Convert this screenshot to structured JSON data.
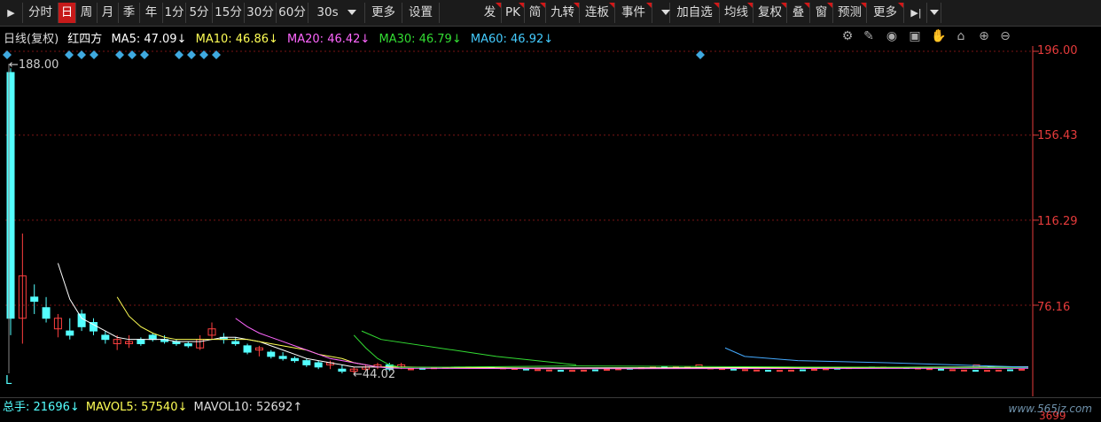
{
  "toolbar": {
    "left_items": [
      "分时",
      "日",
      "周",
      "月",
      "季",
      "年",
      "1分",
      "5分",
      "15分",
      "30分",
      "60分"
    ],
    "interval_select": "30s",
    "more1": "更多",
    "settings": "设置",
    "mid_items": [
      "发",
      "PK",
      "简",
      "九转",
      "连板",
      "事件"
    ],
    "right_items": [
      "加自选",
      "均线",
      "复权",
      "叠",
      "窗",
      "预测",
      "更多"
    ]
  },
  "ma_header": {
    "title": "日线(复权)",
    "stock": "红四方",
    "ma5": "MA5: 47.09↓",
    "ma10": "MA10: 46.86↓",
    "ma20": "MA20: 46.42↓",
    "ma30": "MA30: 46.79↓",
    "ma60": "MA60: 46.92↓"
  },
  "colors": {
    "up": "#ff4040",
    "down": "#54ffff",
    "ma5": "#ffffff",
    "ma10": "#ffff55",
    "ma20": "#ff66ff",
    "ma30": "#33dd33",
    "ma60": "#44aaff",
    "axis": "#e63b3b"
  },
  "y_axis": {
    "labels": [
      "196.00",
      "156.43",
      "116.29",
      "76.16"
    ]
  },
  "annotations": {
    "high": "←188.00",
    "low": "44.02",
    "marker_L": "L"
  },
  "volume": {
    "total": "总手: 21696↓",
    "mavol5": "MAVOL5: 57540↓",
    "mavol10": "MAVOL10: 52692↑",
    "axis_value": "3699"
  },
  "watermark": "www.565jz.com",
  "chart_data": {
    "type": "candlestick",
    "ylim": [
      44,
      196
    ],
    "y_ticks": [
      196.0,
      156.43,
      116.29,
      76.16
    ],
    "candles": [
      [
        186,
        188,
        62,
        70
      ],
      [
        70,
        110,
        58,
        90
      ],
      [
        80,
        86,
        72,
        78
      ],
      [
        75,
        80,
        68,
        70
      ],
      [
        65,
        72,
        61,
        70
      ],
      [
        64,
        70,
        60,
        62
      ],
      [
        72,
        74,
        64,
        66
      ],
      [
        68,
        70,
        62,
        64
      ],
      [
        62,
        64,
        58,
        60
      ],
      [
        58,
        62,
        55,
        60
      ],
      [
        58,
        62,
        56,
        59
      ],
      [
        60,
        61,
        57,
        58
      ],
      [
        62,
        63,
        59,
        60
      ],
      [
        60,
        62,
        58,
        59
      ],
      [
        59,
        60,
        57,
        58
      ],
      [
        58,
        59,
        56,
        57
      ],
      [
        56,
        62,
        55,
        60
      ],
      [
        62,
        68,
        60,
        65
      ],
      [
        61,
        63,
        58,
        60
      ],
      [
        59,
        61,
        57,
        58
      ],
      [
        57,
        58,
        53,
        54
      ],
      [
        55,
        57,
        52,
        56
      ],
      [
        54,
        55,
        51,
        52
      ],
      [
        52,
        54,
        50,
        51
      ],
      [
        51,
        52,
        49,
        50
      ],
      [
        50,
        51,
        47,
        48
      ],
      [
        49,
        50,
        46,
        47
      ],
      [
        48,
        50,
        46,
        49
      ],
      [
        46,
        48,
        44,
        45
      ],
      [
        45,
        47,
        44,
        46
      ],
      [
        46,
        48,
        45,
        47
      ],
      [
        47,
        49,
        46,
        48
      ],
      [
        48,
        49,
        45,
        46
      ],
      [
        47,
        49,
        46,
        48
      ]
    ],
    "ma5": [
      null,
      null,
      null,
      null,
      96,
      79,
      70,
      67,
      64,
      61,
      60,
      60,
      60,
      60,
      59,
      59,
      59,
      60,
      61,
      61,
      60,
      59,
      57,
      55,
      53,
      51,
      50,
      49,
      48,
      47,
      47,
      47,
      47,
      47
    ],
    "ma10": [
      null,
      null,
      null,
      null,
      null,
      null,
      null,
      null,
      null,
      80,
      71,
      66,
      63,
      61,
      60,
      60,
      60,
      60,
      60,
      60,
      60,
      59,
      58,
      57,
      56,
      55,
      53,
      52,
      51,
      49,
      48,
      47,
      47,
      47
    ],
    "ma20": [
      null,
      null,
      null,
      null,
      null,
      null,
      null,
      null,
      null,
      null,
      null,
      null,
      null,
      null,
      null,
      null,
      null,
      null,
      null,
      70,
      66,
      63,
      61,
      59,
      57,
      55,
      53,
      51,
      50,
      49,
      48,
      47,
      46.5,
      46.4
    ],
    "ma30": [
      null,
      null,
      null,
      null,
      null,
      null,
      null,
      null,
      null,
      null,
      null,
      null,
      null,
      null,
      null,
      null,
      null,
      null,
      null,
      null,
      null,
      null,
      null,
      null,
      null,
      null,
      null,
      null,
      null,
      62,
      56,
      51,
      48,
      46.8
    ],
    "ma60": [
      null,
      null,
      null,
      null,
      null,
      null,
      null,
      null,
      null,
      null,
      null,
      null,
      null,
      null,
      null,
      null,
      null,
      null,
      null,
      null,
      null,
      null,
      null,
      null,
      null,
      null,
      null,
      null,
      null,
      null,
      null,
      54,
      50,
      46.9
    ]
  }
}
